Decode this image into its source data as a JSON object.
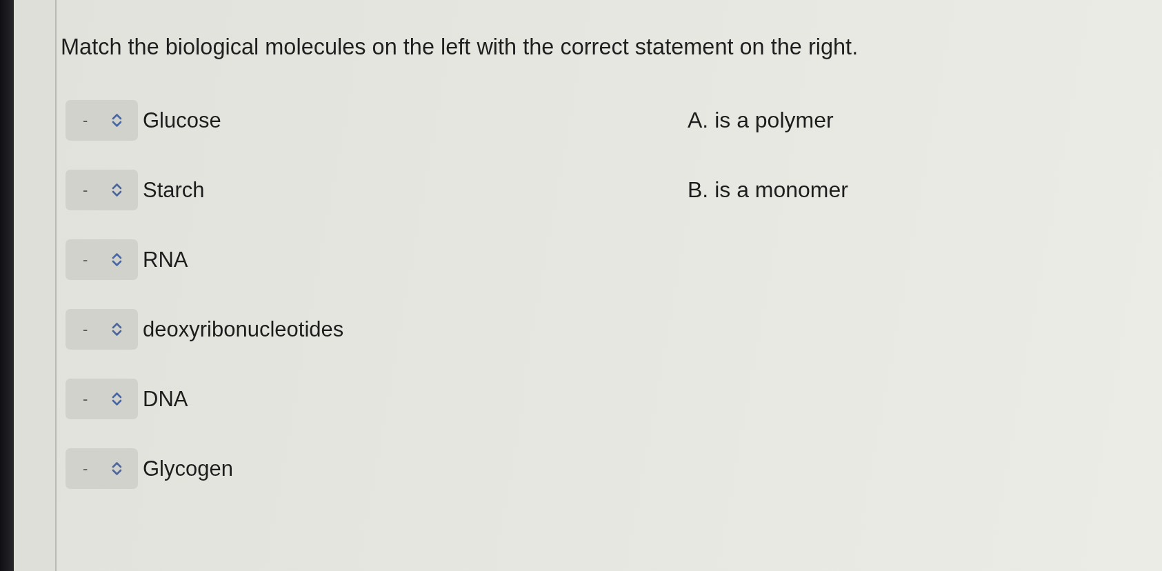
{
  "prompt": "Match the biological molecules on the left with the correct statement on the right.",
  "items": [
    {
      "value": "-",
      "label": "Glucose"
    },
    {
      "value": "-",
      "label": "Starch"
    },
    {
      "value": "-",
      "label": "RNA"
    },
    {
      "value": "-",
      "label": "deoxyribonucleotides"
    },
    {
      "value": "-",
      "label": "DNA"
    },
    {
      "value": "-",
      "label": "Glycogen"
    }
  ],
  "options": [
    "A. is a polymer",
    "B. is a monomer"
  ]
}
